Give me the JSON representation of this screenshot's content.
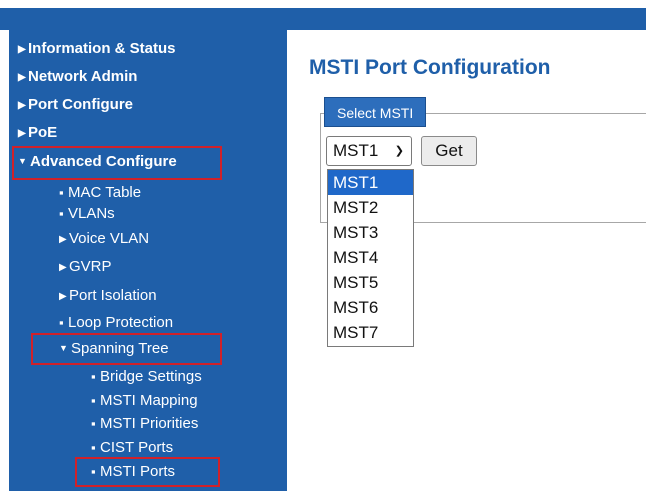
{
  "sidebar": {
    "items": [
      {
        "label": "Information & Status"
      },
      {
        "label": "Network Admin"
      },
      {
        "label": "Port Configure"
      },
      {
        "label": "PoE"
      },
      {
        "label": "Advanced Configure"
      },
      {
        "label": "MAC Table"
      },
      {
        "label": "VLANs"
      },
      {
        "label": "Voice VLAN"
      },
      {
        "label": "GVRP"
      },
      {
        "label": "Port Isolation"
      },
      {
        "label": "Loop Protection"
      },
      {
        "label": "Spanning Tree"
      },
      {
        "label": "Bridge Settings"
      },
      {
        "label": "MSTI Mapping"
      },
      {
        "label": "MSTI Priorities"
      },
      {
        "label": "CIST Ports"
      },
      {
        "label": "MSTI Ports"
      }
    ],
    "highlighted": [
      "Advanced Configure",
      "Spanning Tree",
      "MSTI Ports"
    ],
    "highlight_color": "#d0212a",
    "bg_color": "#1f5fa9"
  },
  "main": {
    "title": "MSTI Port Configuration",
    "legend": "Select MSTI",
    "select": {
      "value": "MST1",
      "options": [
        "MST1",
        "MST2",
        "MST3",
        "MST4",
        "MST5",
        "MST6",
        "MST7"
      ],
      "highlighted_option": "MST1"
    },
    "get_button": "Get"
  },
  "icons": {
    "expand": "triangle-right-icon",
    "collapse": "triangle-down-icon",
    "bullet": "bullet-icon"
  }
}
